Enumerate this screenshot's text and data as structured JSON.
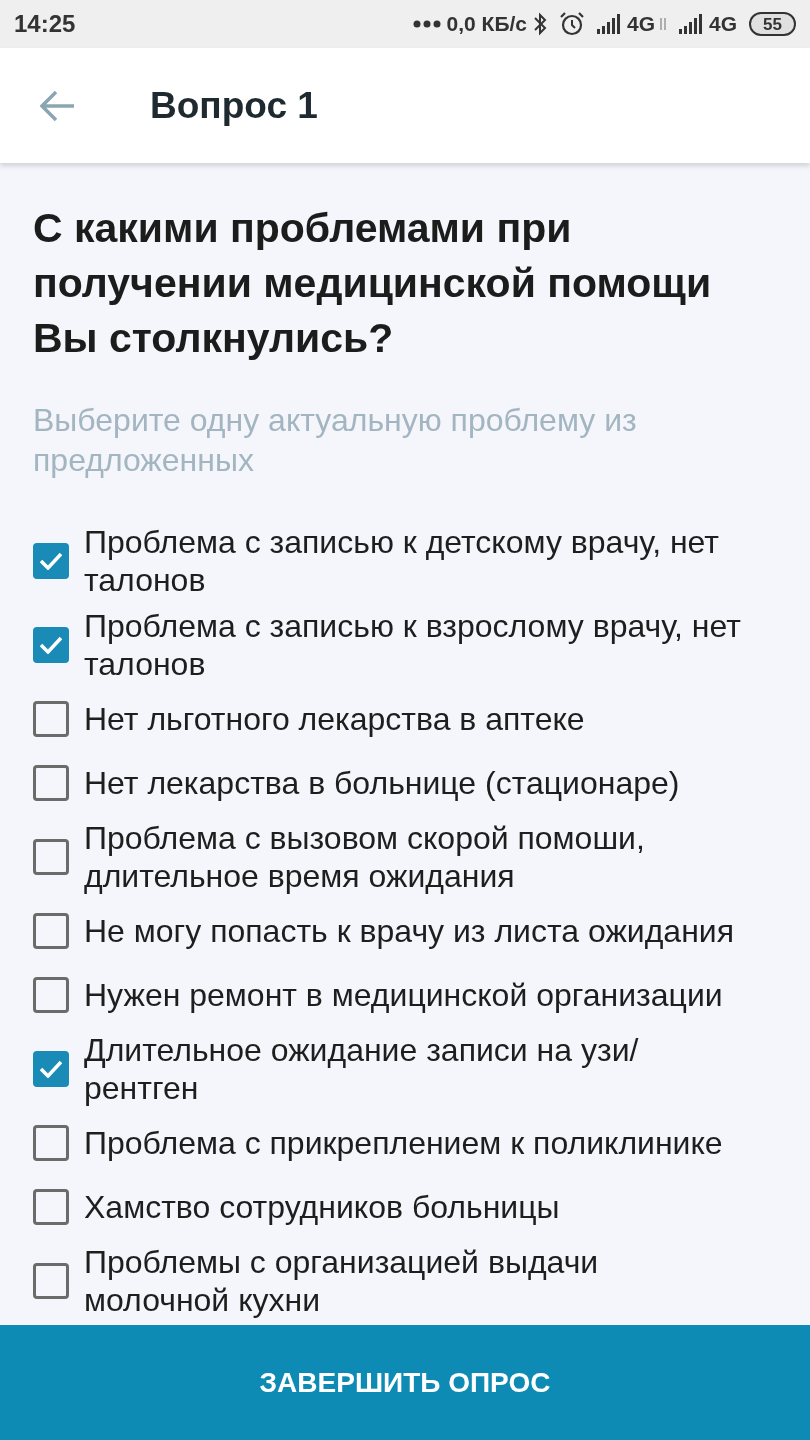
{
  "status_bar": {
    "time": "14:25",
    "speed": "0,0 КБ/с",
    "networks": [
      {
        "label": "4G"
      },
      {
        "label": "4G"
      }
    ],
    "battery": "55"
  },
  "header": {
    "title": "Вопрос 1"
  },
  "question": {
    "title": "С какими проблемами при получении медицинской помощи Вы столкнулись?",
    "hint": "Выберите одну актуальную проблему из предложенных"
  },
  "options": [
    {
      "label": "Проблема с записью к детскому врачу, нет талонов",
      "checked": true
    },
    {
      "label": "Проблема с записью к взрослому врачу, нет талонов",
      "checked": true
    },
    {
      "label": "Нет льготного лекарства в аптеке",
      "checked": false
    },
    {
      "label": "Нет лекарства в больнице (стационаре)",
      "checked": false
    },
    {
      "label": "Проблема с вызовом скорой помоши, длительное время ожидания",
      "checked": false
    },
    {
      "label": "Не могу попасть к врачу из листа ожидания",
      "checked": false
    },
    {
      "label": "Нужен ремонт в медицинской организации",
      "checked": false
    },
    {
      "label": "Длительное ожидание записи на узи/ рентген",
      "checked": true
    },
    {
      "label": "Проблема с прикреплением к поликлинике",
      "checked": false
    },
    {
      "label": "Хамство сотрудников больницы",
      "checked": false
    },
    {
      "label": "Проблемы с организацией выдачи молочной кухни",
      "checked": false
    }
  ],
  "submit_button": {
    "label": "ЗАВЕРШИТЬ ОПРОС"
  }
}
